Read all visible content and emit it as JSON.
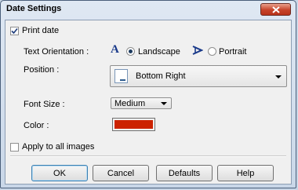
{
  "window": {
    "title": "Date Settings",
    "close_icon": "close-icon"
  },
  "print_date": {
    "label": "Print date",
    "checked": true
  },
  "text_orientation": {
    "label": "Text Orientation :",
    "landscape_glyph": "A",
    "landscape_label": "Landscape",
    "portrait_label": "Portrait",
    "selected": "Landscape"
  },
  "position": {
    "label": "Position :",
    "value": "Bottom Right",
    "icon": "bottom-right-position-icon"
  },
  "font_size": {
    "label": "Font Size :",
    "value": "Medium"
  },
  "color": {
    "label": "Color :",
    "value": "#cc2200"
  },
  "apply_all": {
    "label": "Apply to all images",
    "checked": false
  },
  "buttons": {
    "ok": "OK",
    "cancel": "Cancel",
    "defaults": "Defaults",
    "help": "Help"
  },
  "colors": {
    "accent": "#1f4e9a",
    "glyph": "#1a3a8a"
  }
}
